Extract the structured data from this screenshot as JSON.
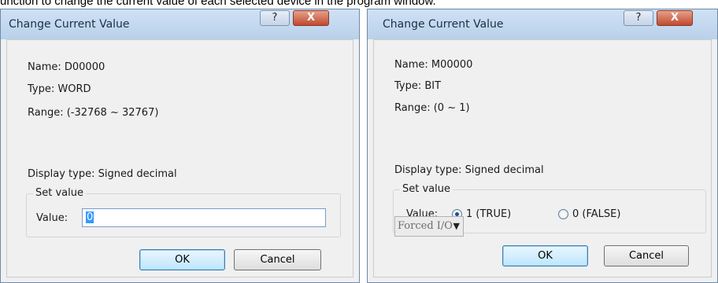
{
  "caption": "unction to change the current value of each selected device in the program window.",
  "dialogs": [
    {
      "title": "Change Current Value",
      "help_glyph": "?",
      "close_glyph": "X",
      "name": "Name: D00000",
      "type": "Type:  WORD",
      "range": "Range: (-32768 ~ 32767)",
      "display_type": "Display type:  Signed decimal",
      "group_label": "Set value",
      "value_label": "Value:",
      "value": "0",
      "ok_label": "OK",
      "cancel_label": "Cancel"
    },
    {
      "title": "Change Current Value",
      "help_glyph": "?",
      "close_glyph": "X",
      "name": "Name: M00000",
      "type": "Type:  BIT",
      "range": "Range: (0 ~ 1)",
      "display_type": "Display type:  Signed decimal",
      "group_label": "Set value",
      "value_label": "Value:",
      "options": [
        {
          "label": "1 (TRUE)",
          "checked": true
        },
        {
          "label": "0 (FALSE)",
          "checked": false
        }
      ],
      "forced_io_label": "Forced I/O",
      "combo_arrow": "▼",
      "ok_label": "OK",
      "cancel_label": "Cancel"
    }
  ]
}
